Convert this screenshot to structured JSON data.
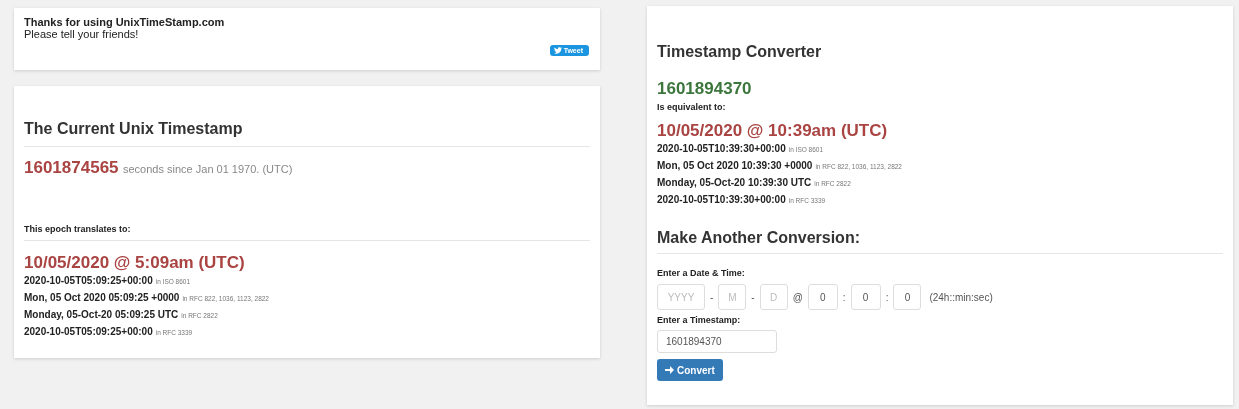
{
  "share_card": {
    "title": "Thanks for using UnixTimeStamp.com",
    "text": "Please tell your friends!",
    "tweet_button": "Tweet"
  },
  "current": {
    "heading": "The Current Unix Timestamp",
    "timestamp": "1601874565",
    "caption": "seconds since Jan 01 1970. (UTC)",
    "translates_label": "This epoch translates to:",
    "date": "10/05/2020 @ 5:09am (UTC)",
    "formats": [
      {
        "value": "2020-10-05T05:09:25+00:00",
        "standard": "in ISO 8601"
      },
      {
        "value": "Mon, 05 Oct 2020 05:09:25 +0000",
        "standard": "in RFC 822, 1036, 1123, 2822"
      },
      {
        "value": "Monday, 05-Oct-20 05:09:25 UTC",
        "standard": "in RFC 2822"
      },
      {
        "value": "2020-10-05T05:09:25+00:00",
        "standard": "in RFC 3339"
      }
    ]
  },
  "converter": {
    "heading": "Timestamp Converter",
    "timestamp": "1601894370",
    "equivalent_label": "Is equivalent to:",
    "date": "10/05/2020 @ 10:39am (UTC)",
    "formats": [
      {
        "value": "2020-10-05T10:39:30+00:00",
        "standard": "in ISO 8601"
      },
      {
        "value": "Mon, 05 Oct 2020 10:39:30 +0000",
        "standard": "in RFC 822, 1036, 1123, 2822"
      },
      {
        "value": "Monday, 05-Oct-20 10:39:30 UTC",
        "standard": "in RFC 2822"
      },
      {
        "value": "2020-10-05T10:39:30+00:00",
        "standard": "in RFC 3339"
      }
    ],
    "another_heading": "Make Another Conversion:",
    "date_time_label": "Enter a Date & Time:",
    "date_fields": [
      {
        "placeholder": "YYYY"
      },
      {
        "separator": "-",
        "placeholder": "M"
      },
      {
        "separator": "-",
        "placeholder": "D"
      },
      {
        "separator": "@",
        "value": "0"
      },
      {
        "separator": ":",
        "value": "0"
      },
      {
        "separator": ":",
        "value": "0"
      }
    ],
    "format_hint": "(24h::min:sec)",
    "timestamp_label": "Enter a Timestamp:",
    "timestamp_value": "1601894370",
    "convert_button": "Convert"
  }
}
